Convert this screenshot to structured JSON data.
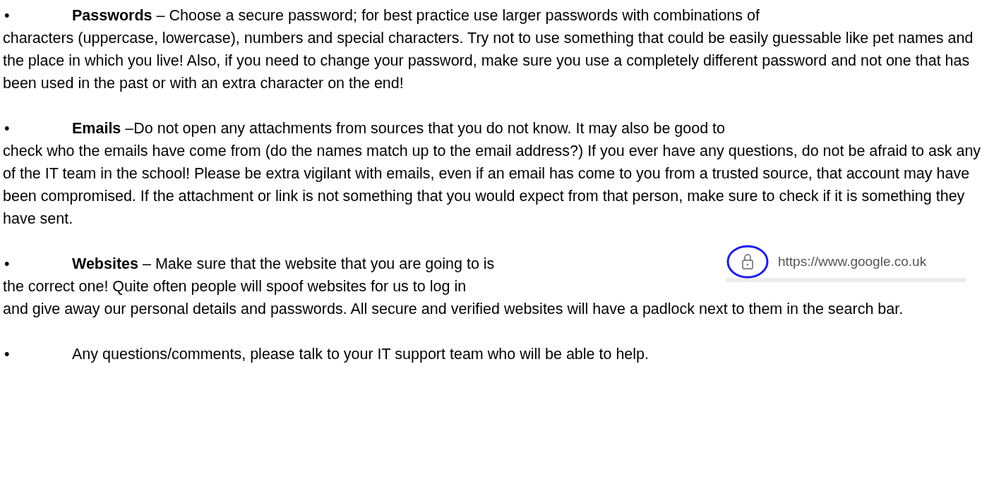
{
  "items": [
    {
      "kind": "text",
      "bullet": "•",
      "lead": "**Passwords** – Choose a secure password; for best practice use larger passwords with combinations of",
      "body": "characters (uppercase, lowercase), numbers and special characters. Try not to use something that could be easily guessable like pet names and the place in which you live! Also, if you need to change your password, make sure you use a completely different password and not one that has been used in the past or with an extra character on the end!"
    },
    {
      "kind": "text",
      "bullet": "•",
      "lead": "**Emails** –Do not open any attachments from sources that you do not know. It may also be good to",
      "body": "check who the emails have come from (do the names match up to the email address?) If you ever have any questions, do not be afraid to ask any of the IT team in the school! Please be extra vigilant with emails, even if an email has come to you from a trusted source, that account may have been compromised. If the attachment or link is not something that you would expect from that person, make sure to check if it is something they have sent."
    },
    {
      "kind": "figure",
      "bullet": "•",
      "lead": "**Websites** – Make sure that the website that you are going to is",
      "body_beside": "the correct one! Quite often people will spoof websites for us to log in",
      "body": "and give away our personal details and passwords. All secure and verified websites will have a padlock next to them in the search bar.",
      "url": "https://www.google.co.uk"
    },
    {
      "kind": "text",
      "bullet": "•",
      "lead": "Any questions/comments, please talk to your IT support team who will be able to help."
    }
  ]
}
